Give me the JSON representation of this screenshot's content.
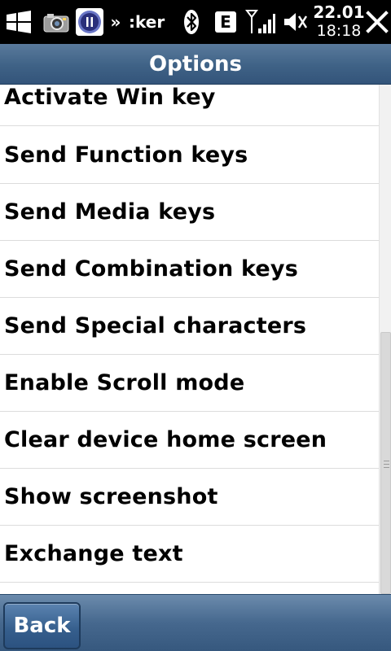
{
  "status_bar": {
    "app_title": ":ker",
    "overflow_glyph": "»",
    "network_badge": "E",
    "date": "22.01",
    "time": "18:18",
    "icons": [
      "windows-start-icon",
      "camera-icon",
      "app-running-icon",
      "bluetooth-icon",
      "edge-network-icon",
      "signal-strength-icon",
      "volume-muted-icon",
      "close-icon"
    ]
  },
  "header": {
    "title": "Options"
  },
  "menu": {
    "items": [
      {
        "label": "Activate Win key"
      },
      {
        "label": "Send Function keys"
      },
      {
        "label": "Send Media keys"
      },
      {
        "label": "Send Combination keys"
      },
      {
        "label": "Send Special characters"
      },
      {
        "label": "Enable Scroll mode"
      },
      {
        "label": "Clear device home screen"
      },
      {
        "label": "Show screenshot"
      },
      {
        "label": "Exchange text"
      }
    ]
  },
  "scrollbar": {
    "position_fraction": 0.48
  },
  "bottom_bar": {
    "back_label": "Back"
  },
  "colors": {
    "header_bg": "#3f6286",
    "bottom_bar_bg": "#46688e",
    "status_bar_bg": "#000000",
    "list_text": "#000000",
    "divider": "#dcdcdc"
  }
}
